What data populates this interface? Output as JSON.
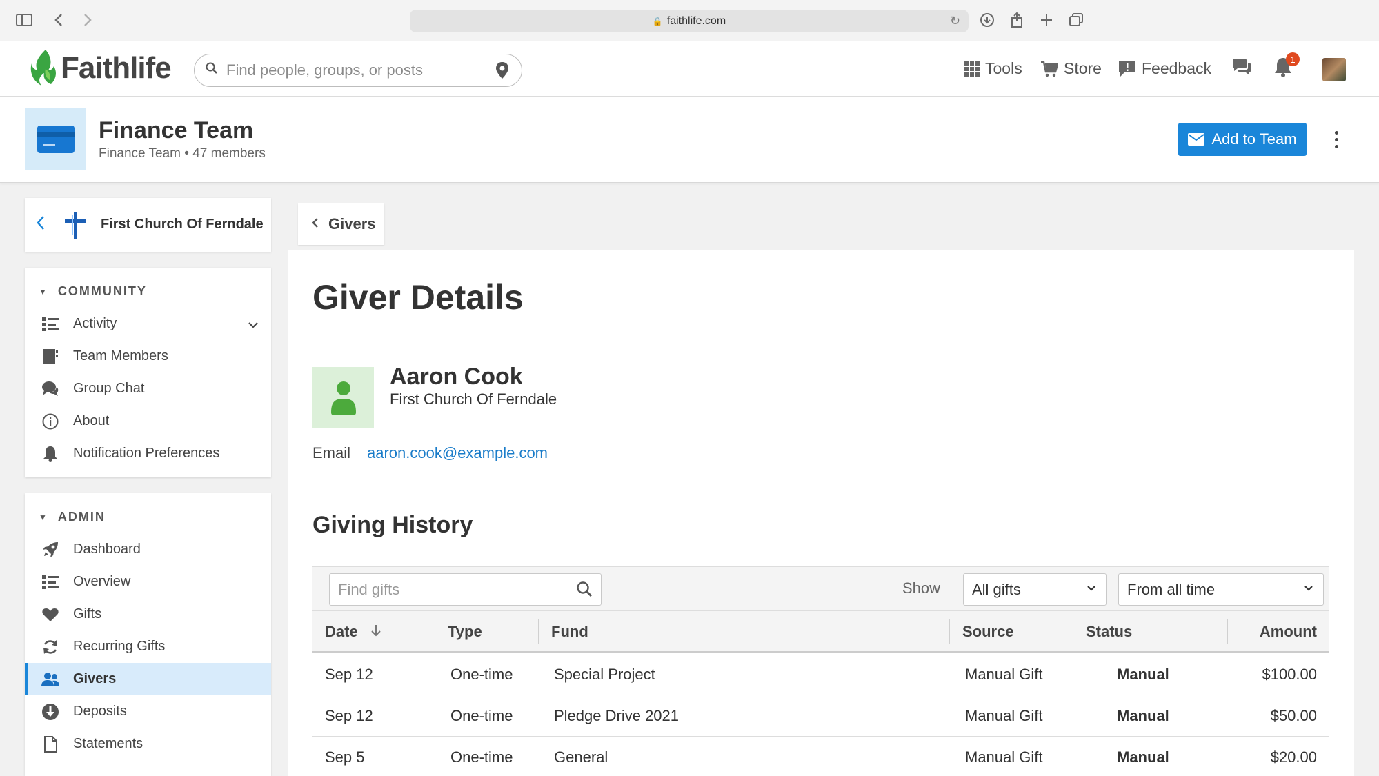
{
  "browser": {
    "url": "faithlife.com"
  },
  "header": {
    "logo_text": "Faithlife",
    "search_placeholder": "Find people, groups, or posts",
    "nav": {
      "tools": "Tools",
      "store": "Store",
      "feedback": "Feedback"
    },
    "notification_count": "1"
  },
  "team": {
    "title": "Finance Team",
    "subtitle": "Finance Team",
    "members": "47 members",
    "add_button": "Add to Team"
  },
  "sidebar": {
    "church_name": "First Church Of Ferndale",
    "community_heading": "COMMUNITY",
    "community_items": [
      {
        "label": "Activity"
      },
      {
        "label": "Team Members"
      },
      {
        "label": "Group Chat"
      },
      {
        "label": "About"
      },
      {
        "label": "Notification Preferences"
      }
    ],
    "admin_heading": "ADMIN",
    "admin_items": [
      {
        "label": "Dashboard"
      },
      {
        "label": "Overview"
      },
      {
        "label": "Gifts"
      },
      {
        "label": "Recurring Gifts"
      },
      {
        "label": "Givers"
      },
      {
        "label": "Deposits"
      },
      {
        "label": "Statements"
      }
    ]
  },
  "main": {
    "breadcrumb": "Givers",
    "page_title": "Giver Details",
    "giver": {
      "name": "Aaron Cook",
      "church": "First Church Of Ferndale",
      "email_label": "Email",
      "email": "aaron.cook@example.com"
    },
    "history_title": "Giving History",
    "filters": {
      "find_placeholder": "Find gifts",
      "show_label": "Show",
      "type_select": "All gifts",
      "time_select": "From all time"
    },
    "columns": {
      "date": "Date",
      "type": "Type",
      "fund": "Fund",
      "source": "Source",
      "status": "Status",
      "amount": "Amount"
    },
    "rows": [
      {
        "date": "Sep 12",
        "type": "One-time",
        "fund": "Special Project",
        "source": "Manual Gift",
        "status": "Manual",
        "amount": "$100.00"
      },
      {
        "date": "Sep 12",
        "type": "One-time",
        "fund": "Pledge Drive 2021",
        "source": "Manual Gift",
        "status": "Manual",
        "amount": "$50.00"
      },
      {
        "date": "Sep 5",
        "type": "One-time",
        "fund": "General",
        "source": "Manual Gift",
        "status": "Manual",
        "amount": "$20.00"
      }
    ]
  },
  "colors": {
    "accent": "#1a86d9",
    "logo_green": "#3aa542",
    "badge": "#e0491f"
  }
}
